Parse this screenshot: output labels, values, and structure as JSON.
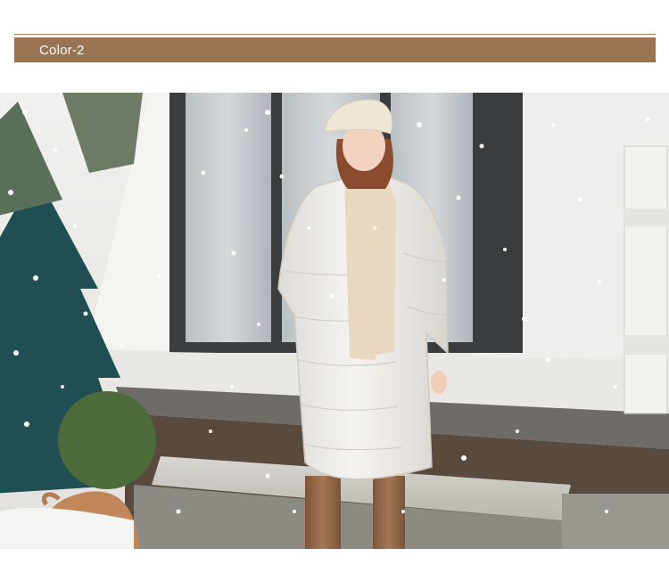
{
  "banner": {
    "label": "Color-2",
    "color": "#9a7352"
  },
  "photo": {
    "subject": "model-wearing-white-long-puffer-coat",
    "colors": {
      "coat": "#f4f2ee",
      "sweater": "#e8d8bf",
      "beret": "#efe7d6",
      "boots": "#9a6e4c",
      "tree": "#1f4f52"
    }
  }
}
